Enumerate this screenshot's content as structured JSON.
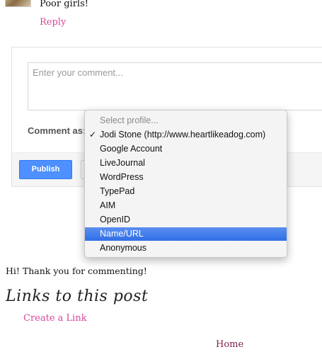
{
  "previous_comment": {
    "text": "Poor girls!",
    "reply_label": "Reply"
  },
  "comment_form": {
    "placeholder": "Enter your comment...",
    "comment_as_label": "Comment as:",
    "publish_label": "Publish",
    "accent_color": "#4d90fe"
  },
  "profile_menu": {
    "header": "Select profile...",
    "checked_item": "Jodi Stone (http://www.heartlikeadog.com)",
    "items": [
      "Jodi Stone (http://www.heartlikeadog.com)",
      "Google Account",
      "LiveJournal",
      "WordPress",
      "TypePad",
      "AIM",
      "OpenID",
      "Name/URL",
      "Anonymous"
    ],
    "highlighted_item": "Name/URL",
    "highlight_color": "#3d7ceb"
  },
  "thanks_message": "Hi! Thank you for commenting!",
  "links_section": {
    "heading": "Links to this post",
    "create_link_label": "Create a Link"
  },
  "footer_nav": {
    "home_label": "Home"
  },
  "link_color": "#d6479b"
}
